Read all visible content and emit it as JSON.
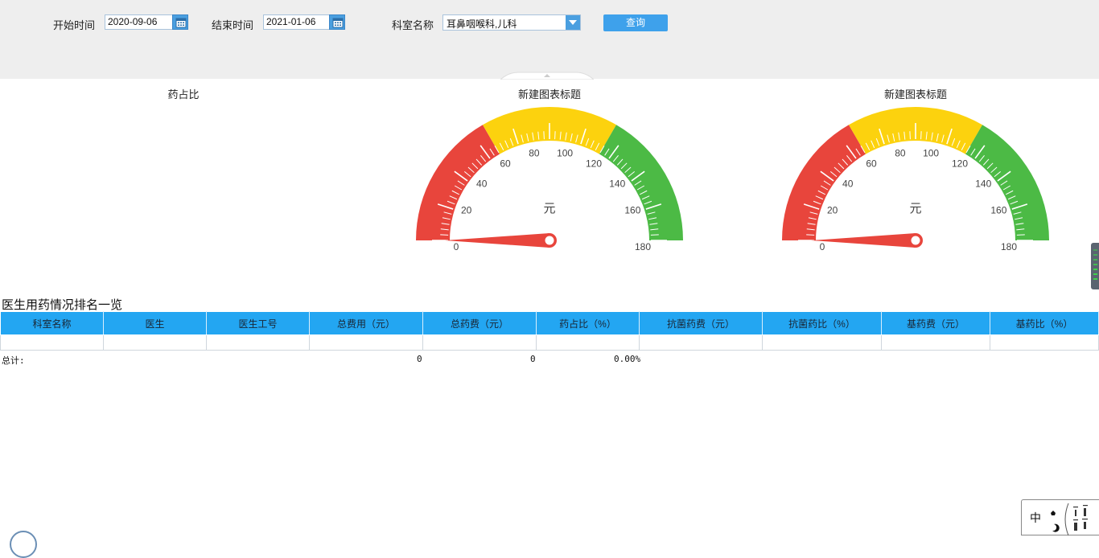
{
  "filters": {
    "start_label": "开始时间",
    "start_value": "2020-09-06",
    "end_label": "结束时间",
    "end_value": "2021-01-06",
    "dept_label": "科室名称",
    "dept_value": "耳鼻咽喉科,儿科",
    "query_label": "查询"
  },
  "charts": {
    "left_title": "药占比",
    "gauge1_title": "新建图表标题",
    "gauge2_title": "新建图表标题"
  },
  "chart_data": [
    {
      "type": "gauge",
      "title": "新建图表标题",
      "unit": "元",
      "min": 0,
      "max": 180,
      "value": 0,
      "tick_labels": [
        "0",
        "20",
        "40",
        "60",
        "80",
        "100",
        "120",
        "140",
        "160",
        "180"
      ],
      "bands": [
        {
          "from": 0,
          "to": 60,
          "color": "#e8453c"
        },
        {
          "from": 60,
          "to": 120,
          "color": "#fcd20e"
        },
        {
          "from": 120,
          "to": 180,
          "color": "#4cba45"
        }
      ]
    },
    {
      "type": "gauge",
      "title": "新建图表标题",
      "unit": "元",
      "min": 0,
      "max": 180,
      "value": 0,
      "tick_labels": [
        "0",
        "20",
        "40",
        "60",
        "80",
        "100",
        "120",
        "140",
        "160",
        "180"
      ],
      "bands": [
        {
          "from": 0,
          "to": 60,
          "color": "#e8453c"
        },
        {
          "from": 60,
          "to": 120,
          "color": "#fcd20e"
        },
        {
          "from": 120,
          "to": 180,
          "color": "#4cba45"
        }
      ]
    }
  ],
  "table": {
    "title": "医生用药情况排名一览",
    "columns": [
      "科室名称",
      "医生",
      "医生工号",
      "总费用（元）",
      "总药费（元）",
      "药占比（%）",
      "抗菌药费（元）",
      "抗菌药比（%）",
      "基药费（元）",
      "基药比（%）"
    ],
    "total_label": "总计:",
    "total_cost": "0",
    "total_drug": "0",
    "total_ratio": "0.00%"
  },
  "stamp": {
    "char": "中"
  },
  "colors": {
    "header_bg": "#23a6f2",
    "accent": "#3ea1eb",
    "red": "#e8453c",
    "yellow": "#fcd20e",
    "green": "#4cba45"
  }
}
